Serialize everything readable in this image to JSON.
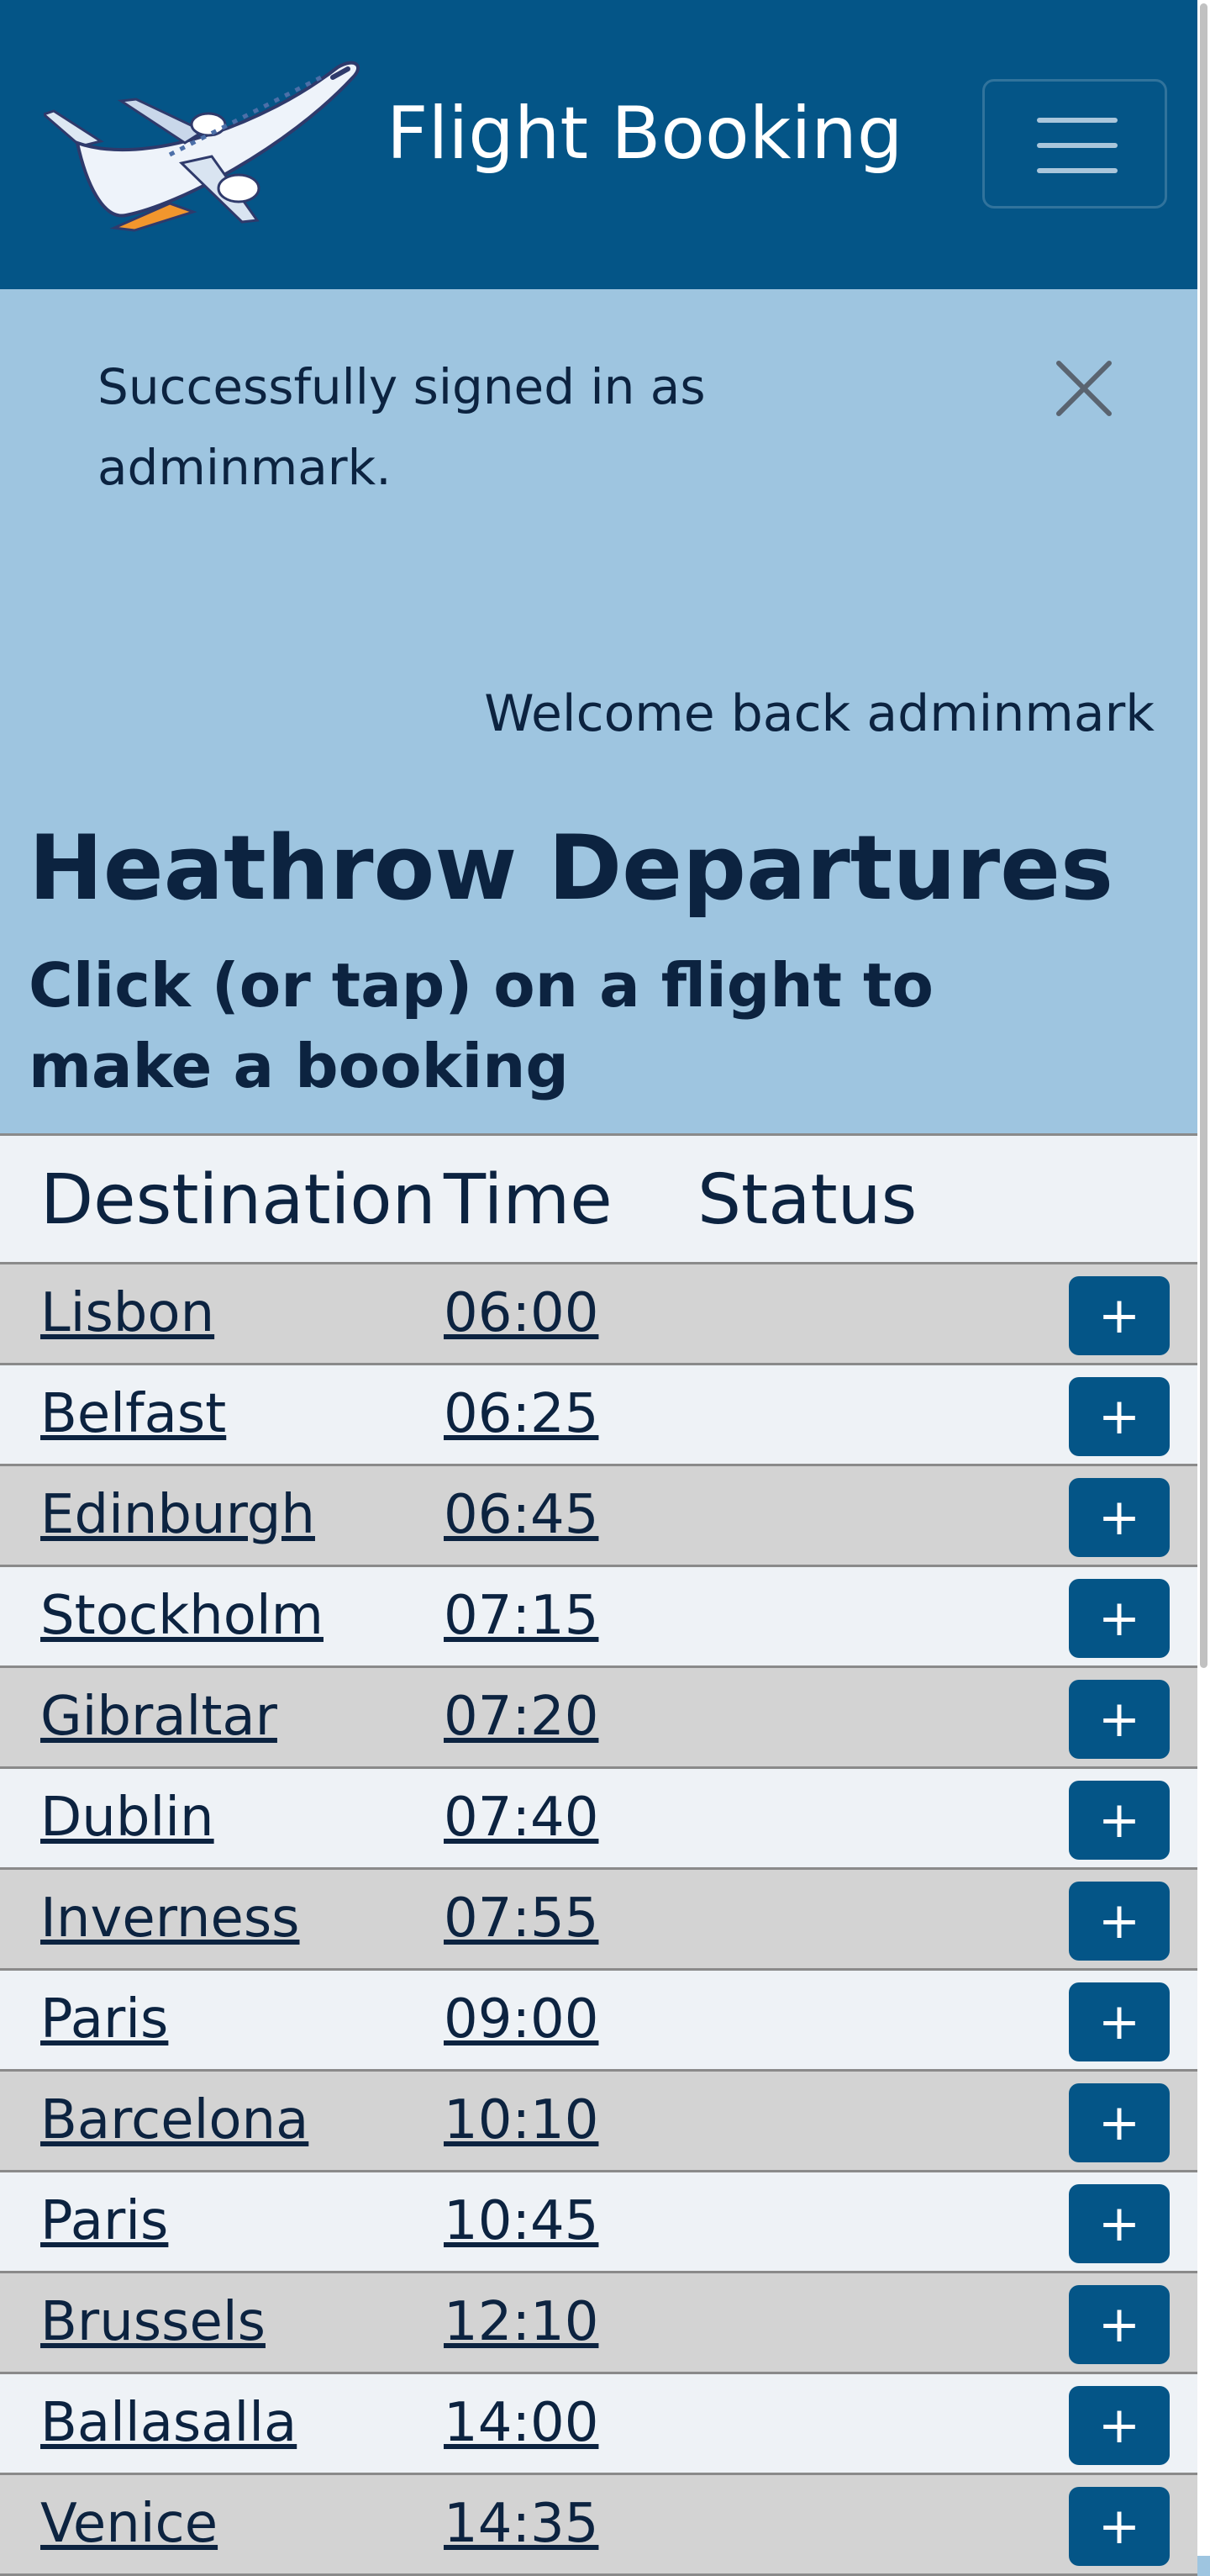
{
  "navbar": {
    "brand": "Flight Booking",
    "logo_icon": "airplane-icon",
    "menu_icon": "hamburger-menu-icon",
    "bg_color": "#045587"
  },
  "alert": {
    "message": "Successfully signed in as adminmark.",
    "close_icon": "close-icon"
  },
  "welcome": "Welcome back adminmark",
  "page": {
    "title": "Heathrow Departures",
    "subtitle": "Click (or tap) on a flight to make a booking"
  },
  "table": {
    "headers": [
      "Destination",
      "Time",
      "Status"
    ],
    "add_label": "+",
    "rows": [
      {
        "destination": "Lisbon",
        "time": "06:00",
        "status": ""
      },
      {
        "destination": "Belfast",
        "time": "06:25",
        "status": ""
      },
      {
        "destination": "Edinburgh",
        "time": "06:45",
        "status": ""
      },
      {
        "destination": "Stockholm",
        "time": "07:15",
        "status": ""
      },
      {
        "destination": "Gibraltar",
        "time": "07:20",
        "status": ""
      },
      {
        "destination": "Dublin",
        "time": "07:40",
        "status": ""
      },
      {
        "destination": "Inverness",
        "time": "07:55",
        "status": ""
      },
      {
        "destination": "Paris",
        "time": "09:00",
        "status": ""
      },
      {
        "destination": "Barcelona",
        "time": "10:10",
        "status": ""
      },
      {
        "destination": "Paris",
        "time": "10:45",
        "status": ""
      },
      {
        "destination": "Brussels",
        "time": "12:10",
        "status": ""
      },
      {
        "destination": "Ballasalla",
        "time": "14:00",
        "status": ""
      },
      {
        "destination": "Venice",
        "time": "14:35",
        "status": ""
      }
    ]
  },
  "colors": {
    "primary": "#045587",
    "page_bg": "#9ec5e0",
    "row_dark": "#d3d3d3",
    "row_light": "#eef2f6",
    "text": "#0c2340"
  }
}
